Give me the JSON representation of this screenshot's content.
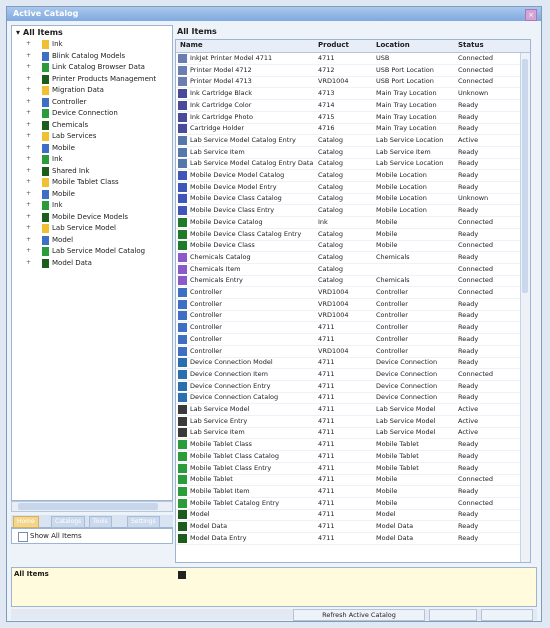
{
  "window": {
    "title": "Active Catalog"
  },
  "tree": {
    "root": "All Items",
    "items": [
      {
        "label": "Ink",
        "icon": "folder-icon"
      },
      {
        "label": "Blink Catalog Models",
        "icon": "folder-icon"
      },
      {
        "label": "Link Catalog Browser Data",
        "icon": "folder-icon"
      },
      {
        "label": "Printer Products Management",
        "icon": "folder-icon"
      },
      {
        "label": "Migration Data",
        "icon": "folder-icon"
      },
      {
        "label": "Controller",
        "icon": "folder-icon"
      },
      {
        "label": "Device Connection",
        "icon": "folder-icon"
      },
      {
        "label": "Chemicals",
        "icon": "folder-icon"
      },
      {
        "label": "Lab Services",
        "icon": "folder-icon"
      },
      {
        "label": "Mobile",
        "icon": "folder-icon"
      },
      {
        "label": "Ink",
        "icon": "folder-icon"
      },
      {
        "label": "Shared Ink",
        "icon": "folder-icon"
      },
      {
        "label": "Mobile Tablet Class",
        "icon": "folder-icon"
      },
      {
        "label": "Mobile",
        "icon": "folder-icon"
      },
      {
        "label": "Ink",
        "icon": "folder-icon"
      },
      {
        "label": "Mobile Device Models",
        "icon": "folder-icon"
      },
      {
        "label": "Lab Service Model",
        "icon": "folder-icon"
      },
      {
        "label": "Model",
        "icon": "folder-icon"
      },
      {
        "label": "Lab Service Model Catalog",
        "icon": "folder-icon"
      },
      {
        "label": "Model Data",
        "icon": "folder-icon"
      }
    ]
  },
  "tabs": [
    "Home",
    "Catalogs",
    "Tools",
    "Settings"
  ],
  "show_all_label": "Show All Items",
  "grid": {
    "title": "All Items",
    "columns": [
      "Name",
      "Product",
      "Location",
      "Status"
    ],
    "rows": [
      {
        "c": [
          "InkJet Printer Model 4711",
          "4711",
          "USB",
          "Connected"
        ],
        "icon": "printer-icon"
      },
      {
        "c": [
          "Printer Model 4712",
          "4712",
          "USB Port Location",
          "Connected"
        ],
        "icon": "printer-icon"
      },
      {
        "c": [
          "Printer Model 4713",
          "VRD1004",
          "USB Port Location",
          "Connected"
        ],
        "icon": "printer-icon"
      },
      {
        "c": [
          "Ink Cartridge Black",
          "4713",
          "Main Tray Location",
          "Unknown"
        ],
        "icon": "ink-icon"
      },
      {
        "c": [
          "Ink Cartridge Color",
          "4714",
          "Main Tray Location",
          "Ready"
        ],
        "icon": "ink-icon"
      },
      {
        "c": [
          "Ink Cartridge Photo",
          "4715",
          "Main Tray Location",
          "Ready"
        ],
        "icon": "ink-icon"
      },
      {
        "c": [
          "Cartridge Holder",
          "4716",
          "Main Tray Location",
          "Ready"
        ],
        "icon": "ink-icon"
      },
      {
        "c": [
          "Lab Service Model Catalog Entry",
          "Catalog",
          "Lab Service Location",
          "Active"
        ],
        "icon": "device-icon"
      },
      {
        "c": [
          "Lab Service Item",
          "Catalog",
          "Lab Service Item",
          "Ready"
        ],
        "icon": "device-icon"
      },
      {
        "c": [
          "Lab Service Model Catalog Entry Data",
          "Catalog",
          "Lab Service Location",
          "Ready"
        ],
        "icon": "device-icon"
      },
      {
        "c": [
          "Mobile Device Model Catalog",
          "Catalog",
          "Mobile Location",
          "Ready"
        ],
        "icon": "mobile-icon"
      },
      {
        "c": [
          "Mobile Device Model Entry",
          "Catalog",
          "Mobile Location",
          "Ready"
        ],
        "icon": "mobile-icon"
      },
      {
        "c": [
          "Mobile Device Class Catalog",
          "Catalog",
          "Mobile Location",
          "Unknown"
        ],
        "icon": "mobile-icon"
      },
      {
        "c": [
          "Mobile Device Class Entry",
          "Catalog",
          "Mobile Location",
          "Ready"
        ],
        "icon": "mobile-icon"
      },
      {
        "c": [
          "Mobile Device Catalog",
          "Ink",
          "Mobile",
          "Connected"
        ],
        "icon": "chip-icon"
      },
      {
        "c": [
          "Mobile Device Class Catalog Entry",
          "Catalog",
          "Mobile",
          "Ready"
        ],
        "icon": "chip-icon"
      },
      {
        "c": [
          "Mobile Device Class",
          "Catalog",
          "Mobile",
          "Connected"
        ],
        "icon": "chip-icon"
      },
      {
        "c": [
          "Chemicals Catalog",
          "Catalog",
          "Chemicals",
          "Ready"
        ],
        "icon": "flask-icon"
      },
      {
        "c": [
          "Chemicals Item",
          "Catalog",
          "",
          "Connected"
        ],
        "icon": "flask-icon"
      },
      {
        "c": [
          "Chemicals Entry",
          "Catalog",
          "Chemicals",
          "Connected"
        ],
        "icon": "flask-icon"
      },
      {
        "c": [
          "Controller",
          "VRD1004",
          "Controller",
          "Connected"
        ],
        "icon": "controller-icon"
      },
      {
        "c": [
          "Controller",
          "VRD1004",
          "Controller",
          "Ready"
        ],
        "icon": "controller-icon"
      },
      {
        "c": [
          "Controller",
          "VRD1004",
          "Controller",
          "Ready"
        ],
        "icon": "controller-icon"
      },
      {
        "c": [
          "Controller",
          "4711",
          "Controller",
          "Ready"
        ],
        "icon": "controller-icon"
      },
      {
        "c": [
          "Controller",
          "4711",
          "Controller",
          "Ready"
        ],
        "icon": "controller-icon"
      },
      {
        "c": [
          "Controller",
          "VRD1004",
          "Controller",
          "Ready"
        ],
        "icon": "controller-icon"
      },
      {
        "c": [
          "Device Connection Model",
          "4711",
          "Device Connection",
          "Ready"
        ],
        "icon": "link-icon"
      },
      {
        "c": [
          "Device Connection Item",
          "4711",
          "Device Connection",
          "Connected"
        ],
        "icon": "link-icon"
      },
      {
        "c": [
          "Device Connection Entry",
          "4711",
          "Device Connection",
          "Ready"
        ],
        "icon": "link-icon"
      },
      {
        "c": [
          "Device Connection Catalog",
          "4711",
          "Device Connection",
          "Ready"
        ],
        "icon": "link-icon"
      },
      {
        "c": [
          "Lab Service Model",
          "4711",
          "Lab Service Model",
          "Active"
        ],
        "icon": "lab-icon"
      },
      {
        "c": [
          "Lab Service Entry",
          "4711",
          "Lab Service Model",
          "Active"
        ],
        "icon": "lab-icon"
      },
      {
        "c": [
          "Lab Service Item",
          "4711",
          "Lab Service Model",
          "Active"
        ],
        "icon": "lab-icon"
      },
      {
        "c": [
          "Mobile Tablet Class",
          "4711",
          "Mobile Tablet",
          "Ready"
        ],
        "icon": "tablet-icon"
      },
      {
        "c": [
          "Mobile Tablet Class Catalog",
          "4711",
          "Mobile Tablet",
          "Ready"
        ],
        "icon": "tablet-icon"
      },
      {
        "c": [
          "Mobile Tablet Class Entry",
          "4711",
          "Mobile Tablet",
          "Ready"
        ],
        "icon": "tablet-icon"
      },
      {
        "c": [
          "Mobile Tablet",
          "4711",
          "Mobile",
          "Connected"
        ],
        "icon": "tablet-icon"
      },
      {
        "c": [
          "Mobile Tablet Item",
          "4711",
          "Mobile",
          "Ready"
        ],
        "icon": "tablet-icon"
      },
      {
        "c": [
          "Mobile Tablet Catalog Entry",
          "4711",
          "Mobile",
          "Connected"
        ],
        "icon": "tablet-icon"
      },
      {
        "c": [
          "Model",
          "4711",
          "Model",
          "Ready"
        ],
        "icon": "model-icon"
      },
      {
        "c": [
          "Model Data",
          "4711",
          "Model Data",
          "Ready"
        ],
        "icon": "model-icon"
      },
      {
        "c": [
          "Model Data Entry",
          "4711",
          "Model Data",
          "Ready"
        ],
        "icon": "model-icon"
      }
    ]
  },
  "bottom": {
    "label": "All Items"
  },
  "statusbar": {
    "button_label": "Refresh Active Catalog"
  },
  "colors": {
    "accent": "#7fa9de",
    "folder": "#f0c030",
    "tree_blue": "#3f6fc4",
    "green": "#2a9d3a"
  }
}
